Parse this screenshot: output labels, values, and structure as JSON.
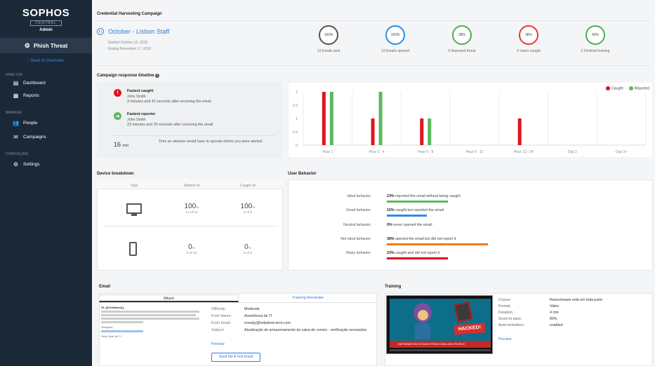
{
  "sidebar": {
    "logo": "SOPHOS",
    "central": "CENTRAL",
    "role": "Admin",
    "product": "Phish Threat",
    "back": "Back to Overview",
    "analyze_label": "ANALYZE",
    "manage_label": "MANAGE",
    "configure_label": "CONFIGURE",
    "items": {
      "dashboard": "Dashboard",
      "reports": "Reports",
      "people": "People",
      "campaigns": "Campaigns",
      "settings": "Settings"
    }
  },
  "header": {
    "page_title": "Credential Harvesting Campaign",
    "campaign_name": "October - Lisbon Staff",
    "started": "Started October 16, 2018",
    "ending": "Ending November 17, 2018"
  },
  "stats": [
    {
      "pct": "100%",
      "label": "13 Emails sent",
      "color": "#555555"
    },
    {
      "pct": "100%",
      "label": "13 Emails opened",
      "color": "#2e8be8"
    },
    {
      "pct": "38%",
      "label": "5 Reported threat",
      "color": "#4caf50"
    },
    {
      "pct": "38%",
      "label": "5 Users caught",
      "color": "#e53935"
    },
    {
      "pct": "40%",
      "label": "2 Finished training",
      "color": "#4caf50"
    }
  ],
  "timeline": {
    "title": "Campaign response timeline",
    "caught_title": "Fastest caught",
    "caught_name": "John Smith",
    "caught_desc": "3 minutes and 42 seconds after receiving the email",
    "reporter_title": "Fastest reporter",
    "reporter_name": "John Smith",
    "reporter_desc": "23 minutes and 20 seconds after receiving the email",
    "window_value": "16",
    "window_unit": "min",
    "window_desc": "Time an attacker would have to operate before you were alerted.",
    "legend_caught": "Caught",
    "legend_reported": "Reported"
  },
  "chart_data": {
    "type": "bar",
    "categories": [
      "Hour 1",
      "Hour 2 - 4",
      "Hour 5 - 8",
      "Hour 9 - 12",
      "Hour 13 - 24",
      "Day 2",
      "Day 3+"
    ],
    "series": [
      {
        "name": "Caught",
        "color": "#e0141e",
        "values": [
          2,
          1,
          1,
          0,
          1,
          0,
          0
        ]
      },
      {
        "name": "Reported",
        "color": "#5cb85c",
        "values": [
          2,
          2,
          1,
          0,
          0,
          0,
          0
        ]
      }
    ],
    "yticks": [
      "0",
      "0.5",
      "1",
      "1.5",
      "2"
    ],
    "ylim": [
      0,
      2
    ],
    "grid": true,
    "legend": "top-right"
  },
  "device": {
    "title": "Device breakdown",
    "col_type": "Type",
    "col_started": "Started on",
    "col_caught": "Caught on",
    "desktop_started": "100",
    "desktop_started_sub": "13 of 13",
    "desktop_caught": "100",
    "desktop_caught_sub": "5 of 5",
    "mobile_started": "0",
    "mobile_started_sub": "0 of 13",
    "mobile_caught": "0",
    "mobile_caught_sub": "0 of 5",
    "pct_sign": "%"
  },
  "behavior": {
    "title": "User Behavior",
    "rows": [
      {
        "label": "Ideal behavior",
        "pct": "23%",
        "text": "reported the email without being caught",
        "value": 23,
        "color": "#5cb85c"
      },
      {
        "label": "Good behavior",
        "pct": "15%",
        "text": "caught but reported the email",
        "value": 15,
        "color": "#2e8be8"
      },
      {
        "label": "Neutral behavior",
        "pct": "0%",
        "text": "never opened the email",
        "value": 0,
        "color": "#999999"
      },
      {
        "label": "Not ideal behavior",
        "pct": "38%",
        "text": "opened the email but did not report it",
        "value": 38,
        "color": "#f57c00"
      },
      {
        "label": "Risky behavior",
        "pct": "23%",
        "text": "caught and did not report it",
        "value": 23,
        "color": "#e0141e"
      }
    ]
  },
  "email": {
    "title": "Email",
    "tab_attack": "Attack",
    "tab_training": "Training Reminder",
    "difficulty_k": "Difficulty:",
    "difficulty_v": "Moderate",
    "from_name_k": "From Name:",
    "from_name_v": "Assistência de TI",
    "from_email_k": "From Email:",
    "from_email_v": "noreply@helpdesk-tech.com",
    "subject_k": "Subject:",
    "subject_v": "Atualização de armazenamento da caixa de correio - verificação necessária",
    "preview": "Preview",
    "send_btn": "Send Me A Test Email",
    "preview_greeting": "Hi, {{FirstName}},",
    "preview_sign": "Obrigado",
    "preview_team": "Help Desk de TI"
  },
  "training": {
    "title": "Training",
    "course_k": "Course:",
    "course_v": "Ransomware está em toda parte",
    "format_k": "Format:",
    "format_v": "Video",
    "duration_k": "Duration:",
    "duration_v": "4 min",
    "score_k": "Score to pass:",
    "score_v": "80%",
    "auto_k": "Auto-reminders:",
    "auto_v": "enabled",
    "preview": "Preview",
    "banner": "INFORMATION STOLEN FROM 6 MILLION PEOPLE",
    "hacked": "HACKED!"
  }
}
